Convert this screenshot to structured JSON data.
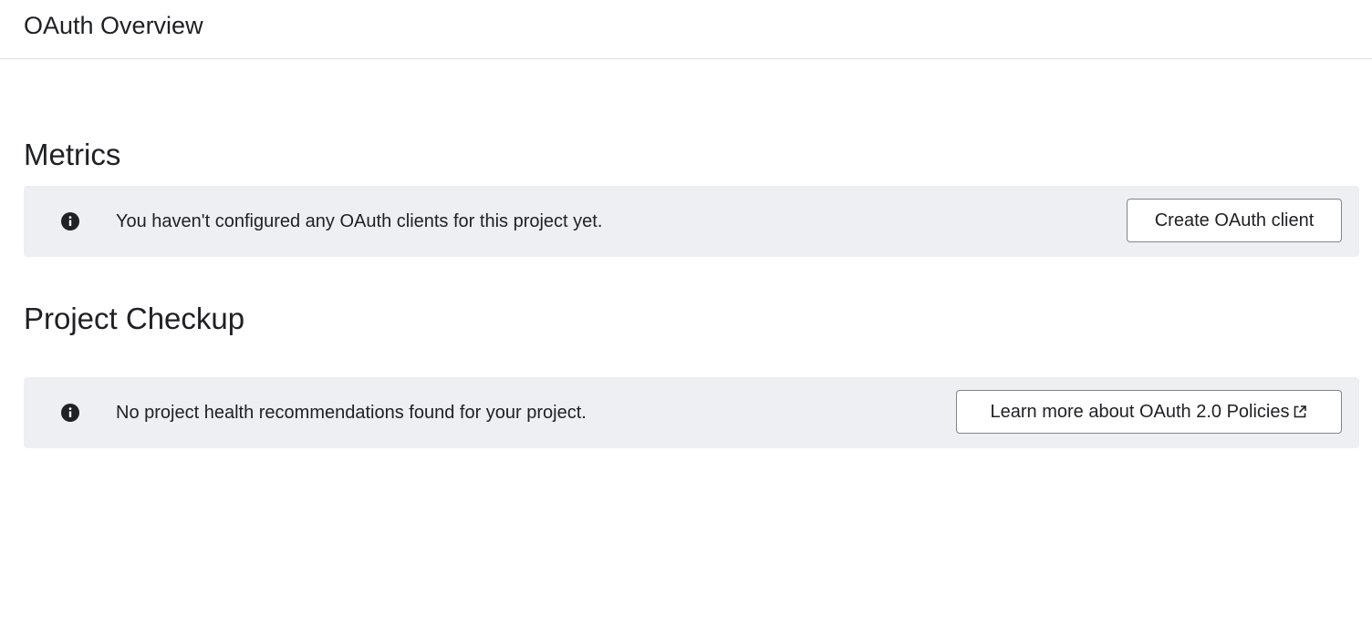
{
  "header": {
    "title": "OAuth Overview"
  },
  "metrics": {
    "heading": "Metrics",
    "banner": {
      "icon": "info-icon",
      "message": "You haven't configured any OAuth clients for this project yet.",
      "button_label": "Create OAuth client"
    }
  },
  "project_checkup": {
    "heading": "Project Checkup",
    "banner": {
      "icon": "info-icon",
      "message": "No project health recommendations found for your project.",
      "button_label": "Learn more about OAuth 2.0 Policies",
      "button_icon": "external-link-icon"
    }
  },
  "colors": {
    "banner_background": "#eeeff2",
    "text": "#202124",
    "button_border": "#80868b",
    "divider": "#dadce0"
  }
}
